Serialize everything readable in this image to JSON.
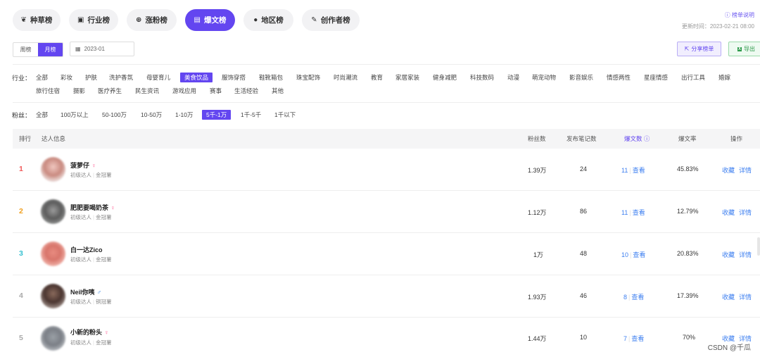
{
  "tabs": [
    {
      "label": "种草榜",
      "icon": "sprout-icon",
      "glyph": "❦"
    },
    {
      "label": "行业榜",
      "icon": "briefcase-icon",
      "glyph": "▣"
    },
    {
      "label": "涨粉榜",
      "icon": "growth-icon",
      "glyph": "⊕"
    },
    {
      "label": "爆文榜",
      "icon": "document-icon",
      "glyph": "▤"
    },
    {
      "label": "地区榜",
      "icon": "location-pin-icon",
      "glyph": "●"
    },
    {
      "label": "创作者榜",
      "icon": "brush-icon",
      "glyph": "✎"
    }
  ],
  "header": {
    "rank_help": "榜单说明",
    "update_time": "更新时间：2023-02-21 08:00"
  },
  "period": {
    "week": "周榜",
    "month": "月榜",
    "date": "2023-01"
  },
  "actions": {
    "share": "分享榜单",
    "export": "导出"
  },
  "industry": {
    "label": "行业：",
    "options": [
      "全部",
      "彩妆",
      "护肤",
      "洗护香氛",
      "母婴育儿",
      "美食饮品",
      "服饰穿搭",
      "鞋靴箱包",
      "珠宝配饰",
      "时尚潮流",
      "教育",
      "家居家装",
      "健身减肥",
      "科技数码",
      "动漫",
      "萌宠动物",
      "影音娱乐",
      "情感两性",
      "星座情感",
      "出行工具",
      "婚嫁",
      "旅行住宿",
      "摄影",
      "医疗养生",
      "民生资讯",
      "游戏应用",
      "赛事",
      "生活经验",
      "其他"
    ],
    "selected": "美食饮品"
  },
  "fans": {
    "label": "粉丝：",
    "options": [
      "全部",
      "100万以上",
      "50-100万",
      "10-50万",
      "1-10万",
      "5千-1万",
      "1千-5千",
      "1千以下"
    ],
    "selected": "5千-1万"
  },
  "table": {
    "headers": {
      "rank": "排行",
      "info": "达人信息",
      "fans": "粉丝数",
      "notes": "发布笔记数",
      "hits": "爆文数",
      "rate": "爆文率",
      "ops": "操作"
    },
    "rows": [
      {
        "rank": "1",
        "name": "菠萝仔",
        "gender": "♀",
        "level": "初级达人",
        "tag": "金冠薯",
        "fans": "1.39万",
        "notes": "24",
        "hits": "11",
        "view": "查看",
        "rate": "45.83%",
        "fav": "收藏",
        "detail": "详情"
      },
      {
        "rank": "2",
        "name": "肥肥要喝奶茶",
        "gender": "♀",
        "level": "初级达人",
        "tag": "金冠薯",
        "fans": "1.12万",
        "notes": "86",
        "hits": "11",
        "view": "查看",
        "rate": "12.79%",
        "fav": "收藏",
        "detail": "详情"
      },
      {
        "rank": "3",
        "name": "白一达Zico",
        "gender": "",
        "level": "初级达人",
        "tag": "金冠薯",
        "fans": "1万",
        "notes": "48",
        "hits": "10",
        "view": "查看",
        "rate": "20.83%",
        "fav": "收藏",
        "detail": "详情"
      },
      {
        "rank": "4",
        "name": "Neil你咦",
        "gender": "♂",
        "level": "初级达人",
        "tag": "铜冠薯",
        "fans": "1.93万",
        "notes": "46",
        "hits": "8",
        "view": "查看",
        "rate": "17.39%",
        "fav": "收藏",
        "detail": "详情"
      },
      {
        "rank": "5",
        "name": "小新的粉头",
        "gender": "♀",
        "level": "初级达人",
        "tag": "金冠薯",
        "fans": "1.44万",
        "notes": "10",
        "hits": "7",
        "view": "查看",
        "rate": "70%",
        "fav": "收藏",
        "detail": "详情"
      }
    ]
  },
  "colors": {
    "accent": "#6346f0",
    "rank1": "#f05a5a",
    "rank2": "#f0a020",
    "rank3": "#35c0d0",
    "rank_other": "#aaaaaa",
    "link": "#3d7ff0"
  },
  "watermark": "CSDN @千瓜"
}
